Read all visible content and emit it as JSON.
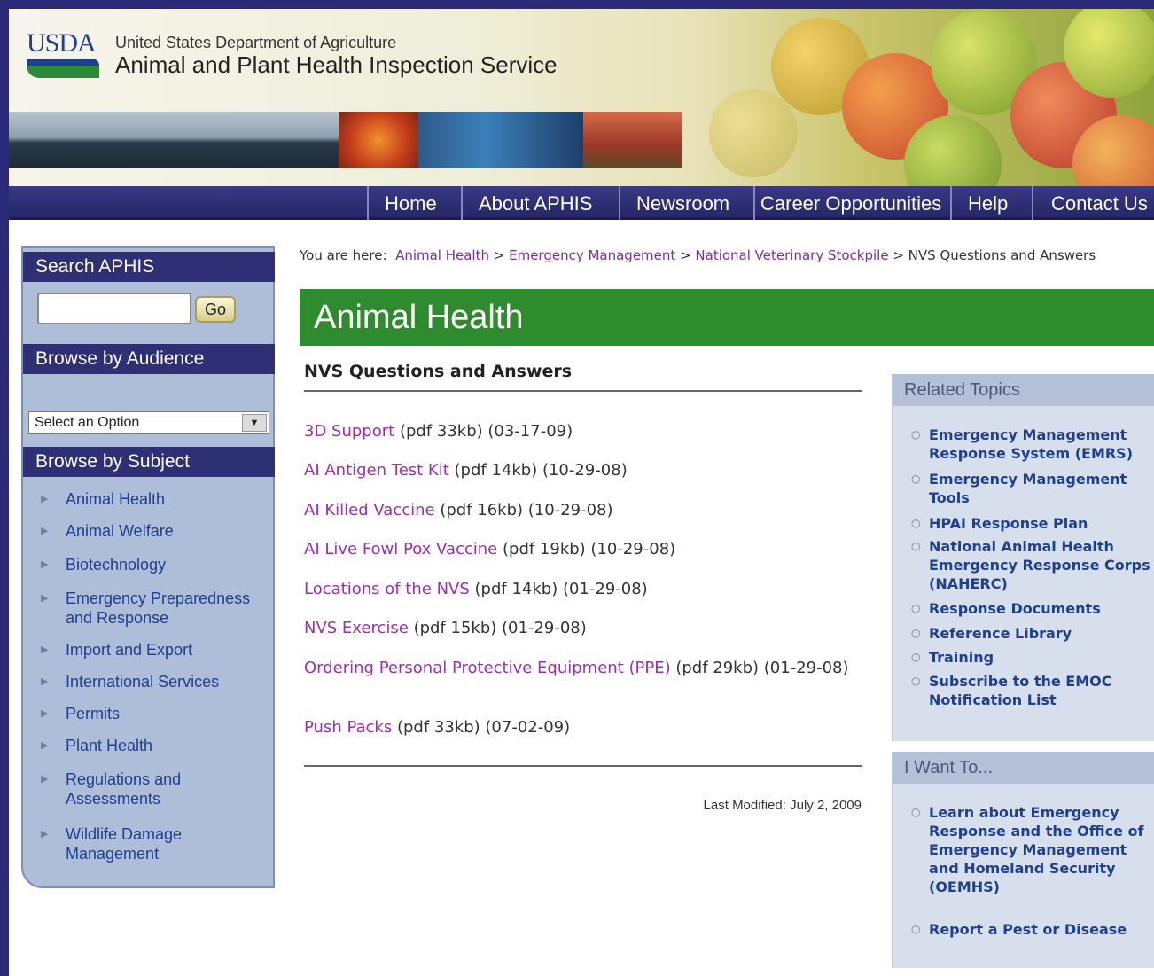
{
  "header": {
    "logo_text": "USDA",
    "agency_top": "United States Department of Agriculture",
    "agency_main": "Animal and Plant Health Inspection Service"
  },
  "nav": [
    "Home",
    "About APHIS",
    "Newsroom",
    "Career Opportunities",
    "Help",
    "Contact Us"
  ],
  "sidebar": {
    "search_title": "Search APHIS",
    "search_value": "",
    "go_label": "Go",
    "audience_title": "Browse by Audience",
    "audience_selected": "Select an Option",
    "subject_title": "Browse by Subject",
    "subjects": [
      "Animal Health",
      "Animal Welfare",
      "Biotechnology",
      "Emergency Preparedness and Response",
      "Import and Export",
      "International Services",
      "Permits",
      "Plant Health",
      "Regulations and Assessments",
      "Wildlife Damage Management"
    ]
  },
  "breadcrumb": {
    "prefix": "You are here:",
    "links": [
      "Animal Health",
      "Emergency Management",
      "National Veterinary Stockpile"
    ],
    "current": "NVS Questions and Answers"
  },
  "banner": "Animal Health",
  "main": {
    "title": "NVS Questions and Answers",
    "documents": [
      {
        "link": "3D Support",
        "info": "(pdf 33kb) (03-17-09)"
      },
      {
        "link": "AI Antigen Test Kit",
        "info": "(pdf 14kb) (10-29-08)"
      },
      {
        "link": "AI Killed Vaccine",
        "info": "(pdf 16kb) (10-29-08)"
      },
      {
        "link": "AI Live Fowl Pox Vaccine",
        "info": "(pdf 19kb) (10-29-08)"
      },
      {
        "link": "Locations of the NVS",
        "info": "(pdf 14kb) (01-29-08)"
      },
      {
        "link": "NVS Exercise",
        "info": "(pdf 15kb) (01-29-08)"
      },
      {
        "link": "Ordering Personal Protective Equipment (PPE)",
        "info": "(pdf 29kb) (01-29-08)"
      },
      {
        "link": "Push Packs",
        "info": "(pdf 33kb) (07-02-09)"
      }
    ],
    "last_modified": "Last Modified: July 2, 2009"
  },
  "related": {
    "title": "Related Topics",
    "items": [
      "Emergency Management Response System (EMRS)",
      "Emergency Management Tools",
      "HPAI Response Plan",
      "National Animal Health Emergency Response Corps (NAHERC)",
      "Response Documents",
      "Reference Library",
      "Training",
      "Subscribe to the EMOC Notification List"
    ]
  },
  "want": {
    "title": "I Want To...",
    "items": [
      "Learn about Emergency Response and the Office of Emergency Management and Homeland Security (OEMHS)",
      "Report a Pest or Disease"
    ]
  },
  "colors": {
    "nav_bg": "#2f2f75",
    "banner_green": "#2e8b2e",
    "link_purple": "#9b2fae",
    "link_blue": "#1f3f8f",
    "sidebar_bg": "#aebdd8"
  }
}
